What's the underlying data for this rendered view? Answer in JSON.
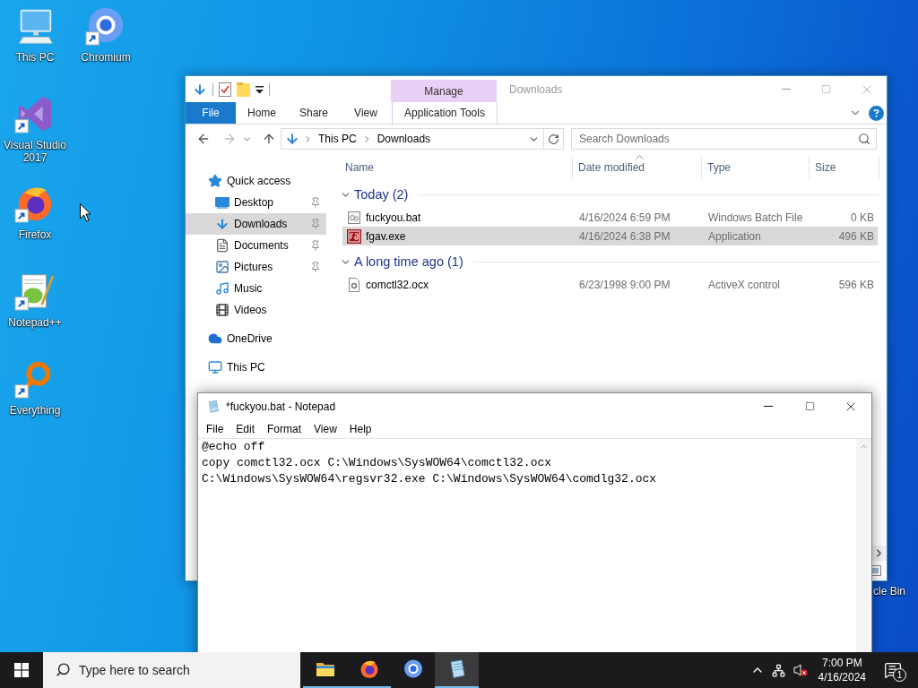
{
  "desktop_icons": [
    {
      "label": "This PC",
      "kind": "pc",
      "shortcut": false
    },
    {
      "label": "Chromium",
      "kind": "chromium",
      "shortcut": true
    },
    {
      "label": "Visual Studio 2017",
      "kind": "visual-studio",
      "shortcut": true
    },
    {
      "label": "Firefox",
      "kind": "firefox",
      "shortcut": true
    },
    {
      "label": "Notepad++",
      "kind": "notepadpp",
      "shortcut": true
    },
    {
      "label": "Everything",
      "kind": "everything",
      "shortcut": true
    }
  ],
  "recycle_bin": {
    "label": "cle Bin"
  },
  "explorer": {
    "title": "Downloads",
    "context_group": "Manage",
    "ribbon_tabs": [
      {
        "label": "File",
        "kind": "file"
      },
      {
        "label": "Home",
        "kind": "plain"
      },
      {
        "label": "Share",
        "kind": "plain"
      },
      {
        "label": "View",
        "kind": "plain"
      },
      {
        "label": "Application Tools",
        "kind": "context"
      }
    ],
    "breadcrumb": [
      "This PC",
      "Downloads"
    ],
    "search": {
      "placeholder": "Search Downloads"
    },
    "navigation": [
      {
        "label": "Quick access",
        "kind": "star",
        "selected": false,
        "children": [
          {
            "label": "Desktop",
            "kind": "desktop",
            "pinned": true,
            "selected": false
          },
          {
            "label": "Downloads",
            "kind": "downloads",
            "pinned": true,
            "selected": true
          },
          {
            "label": "Documents",
            "kind": "documents",
            "pinned": true,
            "selected": false
          },
          {
            "label": "Pictures",
            "kind": "pictures",
            "pinned": true,
            "selected": false
          },
          {
            "label": "Music",
            "kind": "music",
            "pinned": false,
            "selected": false
          },
          {
            "label": "Videos",
            "kind": "videos",
            "pinned": false,
            "selected": false
          }
        ]
      },
      {
        "label": "OneDrive",
        "kind": "onedrive",
        "selected": false
      },
      {
        "label": "This PC",
        "kind": "pc",
        "selected": false
      }
    ],
    "columns": [
      {
        "label": "Name",
        "sorted": false
      },
      {
        "label": "Date modified",
        "sorted": true
      },
      {
        "label": "Type",
        "sorted": false
      },
      {
        "label": "Size",
        "sorted": false
      }
    ],
    "groups": [
      {
        "title": "Today (2)",
        "expanded": true,
        "files": [
          {
            "name": "fuckyou.bat",
            "kind": "batch",
            "date": "4/16/2024 6:59 PM",
            "type": "Windows Batch File",
            "size": "0 KB",
            "selected": false
          },
          {
            "name": "fgav.exe",
            "kind": "application",
            "date": "4/16/2024 6:38 PM",
            "type": "Application",
            "size": "496 KB",
            "selected": true
          }
        ]
      },
      {
        "title": "A long time ago (1)",
        "expanded": true,
        "files": [
          {
            "name": "comctl32.ocx",
            "kind": "control",
            "date": "6/23/1998 9:00 PM",
            "type": "ActiveX control",
            "size": "596 KB",
            "selected": false
          }
        ]
      }
    ]
  },
  "notepad": {
    "title": "*fuckyou.bat - Notepad",
    "menu": [
      "File",
      "Edit",
      "Format",
      "View",
      "Help"
    ],
    "lines": [
      "@echo off",
      "copy comctl32.ocx C:\\Windows\\SysWOW64\\comctl32.ocx",
      "C:\\Windows\\SysWOW64\\regsvr32.exe C:\\Windows\\SysWOW64\\comdlg32.ocx"
    ]
  },
  "taskbar": {
    "search": {
      "placeholder": "Type here to search"
    },
    "apps": [
      {
        "kind": "explorer",
        "running": true,
        "active": false
      },
      {
        "kind": "firefox",
        "running": true,
        "active": false
      },
      {
        "kind": "chromium",
        "running": false,
        "active": false
      },
      {
        "kind": "notepad",
        "running": true,
        "active": true
      }
    ],
    "clock": {
      "time": "7:00 PM",
      "date": "4/16/2024"
    },
    "notifications": "1"
  }
}
